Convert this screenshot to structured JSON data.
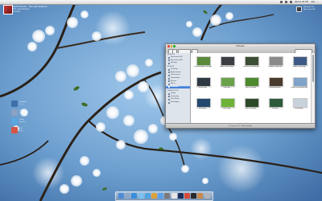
{
  "menubar": {
    "apple": "",
    "clock": "Wed 6:36 PM",
    "user": "Alex"
  },
  "now_playing": {
    "title": "Garth Brooks - The Lost Sessions",
    "subtitle": "The Lost Sessions",
    "sub2": "Country"
  },
  "top_right_widget": {
    "line1": "MacBook Pro",
    "line2": "Macintosh HD"
  },
  "side_widget": {
    "items": [
      {
        "title": "Contacts",
        "sub": "3 new"
      },
      {
        "title": "Mail",
        "sub": "2 unread"
      },
      {
        "title": "iChat",
        "sub": "Available"
      },
      {
        "title": "iCal",
        "sub": "Today"
      }
    ]
  },
  "finder": {
    "title": "Pictures",
    "search_placeholder": "",
    "sidebar_sections": [
      "DEVICES",
      "PLACES",
      "SEARCH FOR"
    ],
    "devices": [
      "Macintosh HD",
      "Macintosh HD",
      "Backup"
    ],
    "places": [
      "Desktop",
      "Applications",
      "Documents",
      "Downloads",
      "Movies",
      "Music",
      "Pictures"
    ],
    "search": [
      "Today",
      "Yesterday",
      "Past Week",
      "All Images"
    ],
    "files": [
      {
        "name": "1900_cornflakes_1280.jpg",
        "color": "#5b8a3a"
      },
      {
        "name": "apple_sliverwht.jpg",
        "color": "#3a3d42"
      },
      {
        "name": "Corvette_by_Stylize.jpg",
        "color": "#3b4d32"
      },
      {
        "name": "Crumpled_Paper.jpg",
        "color": "#8a8a8a"
      },
      {
        "name": "Drops_of_light.jpg",
        "color": "#3e5a86"
      },
      {
        "name": "Essence.jpg",
        "color": "#2e3944"
      },
      {
        "name": "Grass.jpg",
        "color": "#6aa24a"
      },
      {
        "name": "Green_Leaf.jpg",
        "color": "#4c8a2e"
      },
      {
        "name": "Loudspeaker.jpg",
        "color": "#4a3b2c"
      },
      {
        "name": "Flowers_by_Stephen.jpg",
        "color": "#7fa3c9"
      },
      {
        "name": "Aurora.jpg",
        "color": "#24496e"
      },
      {
        "name": "Leaves.jpg",
        "color": "#6eb338"
      },
      {
        "name": "Dark_Grass.jpg",
        "color": "#2c4a28"
      },
      {
        "name": "Moss.jpg",
        "color": "#2e5a3c"
      },
      {
        "name": "Window.jpg",
        "color": "#c8d0da"
      }
    ],
    "status": "15 items, 112.7 GB available"
  },
  "dock": {
    "icons": [
      {
        "name": "finder-icon",
        "color": "#4f8bd6"
      },
      {
        "name": "mail-icon",
        "color": "#8fa8c8"
      },
      {
        "name": "safari-icon",
        "color": "#3a8fdd"
      },
      {
        "name": "ichat-icon",
        "color": "#7cc0f0"
      },
      {
        "name": "itunes-icon",
        "color": "#4fa3e0"
      },
      {
        "name": "iphoto-icon",
        "color": "#d9a23a"
      },
      {
        "name": "app-store-icon",
        "color": "#5aa0e8"
      },
      {
        "name": "preferences-icon",
        "color": "#7a7a7a"
      },
      {
        "name": "textedit-icon",
        "color": "#e6e6e6"
      },
      {
        "name": "photoshop-icon",
        "color": "#1c2e5a"
      },
      {
        "name": "calendar-icon",
        "color": "#d74a3a"
      },
      {
        "name": "terminal-icon",
        "color": "#2a2a2a"
      },
      {
        "name": "downloads-stack-icon",
        "color": "#c98a4a"
      },
      {
        "name": "trash-icon",
        "color": "#b0b6bd"
      }
    ]
  }
}
